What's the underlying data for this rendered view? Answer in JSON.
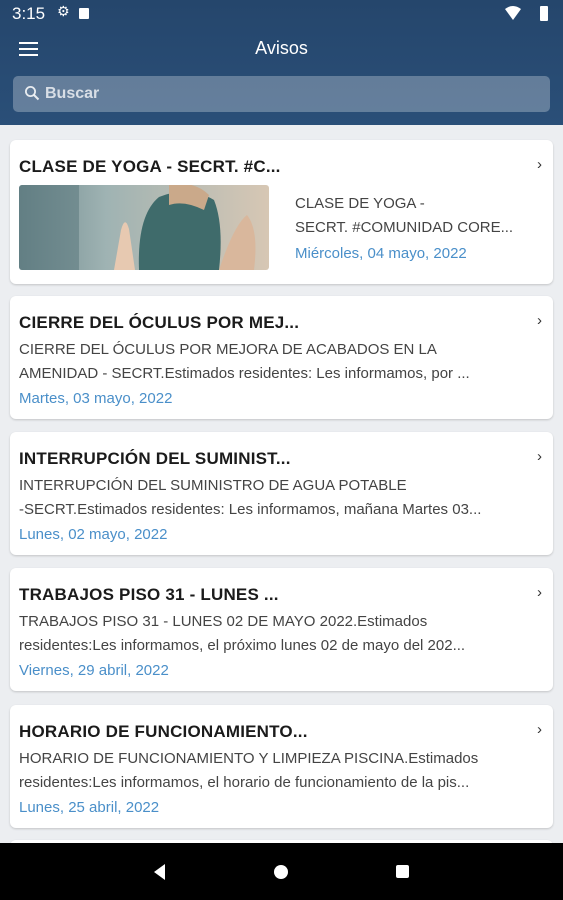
{
  "status_bar": {
    "time": "3:15"
  },
  "header": {
    "title": "Avisos"
  },
  "search": {
    "placeholder": "Buscar"
  },
  "notices": [
    {
      "title": "CLASE DE YOGA - SECRT. #C...",
      "text_lines": [
        "CLASE DE YOGA -",
        "SECRT. #COMUNIDAD CORE..."
      ],
      "date": "Miércoles, 04 mayo, 2022",
      "has_image": true
    },
    {
      "title": "CIERRE DEL ÓCULUS POR MEJ...",
      "text_lines": [
        "CIERRE DEL ÓCULUS POR MEJORA DE ACABADOS EN LA",
        "AMENIDAD - SECRT.Estimados residentes: Les informamos, por ..."
      ],
      "date": "Martes, 03 mayo, 2022"
    },
    {
      "title": "INTERRUPCIÓN DEL SUMINIST...",
      "text_lines": [
        "INTERRUPCIÓN DEL SUMINISTRO DE AGUA POTABLE",
        "-SECRT.Estimados residentes: Les informamos, mañana Martes 03..."
      ],
      "date": "Lunes, 02 mayo, 2022"
    },
    {
      "title": "TRABAJOS PISO 31 - LUNES ...",
      "text_lines": [
        "TRABAJOS PISO 31 - LUNES 02 DE MAYO 2022.Estimados",
        "residentes:Les informamos, el próximo lunes 02 de mayo del 202..."
      ],
      "date": "Viernes, 29 abril, 2022"
    },
    {
      "title": "HORARIO DE FUNCIONAMIENTO...",
      "text_lines": [
        "HORARIO DE FUNCIONAMIENTO Y LIMPIEZA PISCINA.Estimados",
        "residentes:Les informamos, el horario de funcionamiento de la pis..."
      ],
      "date": "Lunes, 25 abril, 2022"
    }
  ],
  "icons": {
    "menu": "hamburger-menu-icon",
    "search": "search-icon",
    "chevron": "chevron-right-icon",
    "nav_back": "back-triangle-icon",
    "nav_home": "home-circle-icon",
    "nav_recents": "recents-square-icon"
  },
  "colors": {
    "header": "#25466c",
    "date_accent": "#4a8fc9",
    "background": "#eceef1"
  }
}
